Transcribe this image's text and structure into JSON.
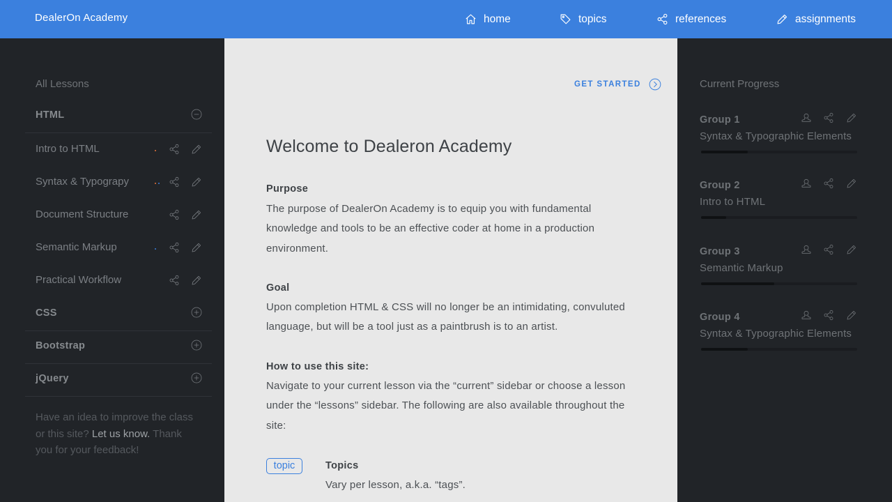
{
  "topbar": {
    "brand": "DealerOn Academy",
    "nav": [
      {
        "label": "home",
        "icon": "home-icon"
      },
      {
        "label": "topics",
        "icon": "tag-icon"
      },
      {
        "label": "references",
        "icon": "share-icon"
      },
      {
        "label": "assignments",
        "icon": "pencil-icon"
      }
    ]
  },
  "left": {
    "title": "All Lessons",
    "sections": [
      {
        "title": "HTML",
        "state": "expanded"
      },
      {
        "title": "CSS",
        "state": "collapsed"
      },
      {
        "title": "Bootstrap",
        "state": "collapsed"
      },
      {
        "title": "jQuery",
        "state": "collapsed"
      }
    ],
    "lessons": [
      {
        "label": "Intro to HTML",
        "dots": [
          "#e8743b"
        ]
      },
      {
        "label": "Syntax & Typograpy",
        "dots": [
          "#e8743b",
          "#3b80de"
        ]
      },
      {
        "label": "Document Structure",
        "dots": []
      },
      {
        "label": "Semantic Markup",
        "dots": [
          "#3b80de"
        ]
      },
      {
        "label": "Practical Workflow",
        "dots": []
      }
    ],
    "feedback": {
      "text_a": "Have an idea to improve the class or this site? ",
      "link": "Let us know.",
      "text_b": " Thank you for your feedback!"
    }
  },
  "main": {
    "get_started": "GET STARTED",
    "title": "Welcome to Dealeron Academy",
    "purpose_heading": "Purpose",
    "purpose_text": "The purpose of DealerOn Academy is to equip you with fundamental knowledge and tools to be an effective coder at home in a production environment.",
    "goal_heading": "Goal",
    "goal_text": "Upon completion HTML & CSS will no longer be an intimidating, convuluted language, but will be a tool just as a paintbrush is to an artist.",
    "howto_heading": "How to use this site:",
    "howto_text": "Navigate to your current lesson via the “current” sidebar or choose a lesson under the “lessons” sidebar. The following are also available throughout the site:",
    "topic_tag": "topic",
    "topics_heading": "Topics",
    "topics_text": "Vary per lesson, a.k.a. “tags”."
  },
  "right": {
    "title": "Current Progress",
    "groups": [
      {
        "name": "Group 1",
        "lesson": "Syntax & Typographic Elements",
        "progress": 0.3
      },
      {
        "name": "Group 2",
        "lesson": "Intro to HTML",
        "progress": 0.16
      },
      {
        "name": "Group 3",
        "lesson": "Semantic Markup",
        "progress": 0.47
      },
      {
        "name": "Group 4",
        "lesson": "Syntax & Typographic Elements",
        "progress": 0.3
      }
    ]
  },
  "colors": {
    "accent": "#3b80de",
    "sidebar_bg": "#212428",
    "main_bg": "#e8e8e8",
    "dot_orange": "#e8743b",
    "dot_blue": "#3b80de"
  }
}
